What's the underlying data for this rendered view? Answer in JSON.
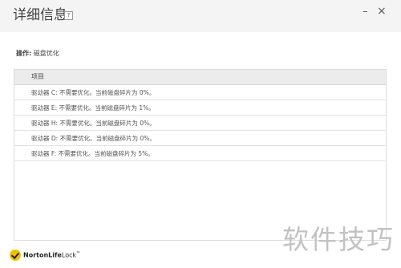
{
  "window": {
    "title": "详细信息",
    "help_label": "?",
    "minimize_label": "–",
    "close_label": "×"
  },
  "operation": {
    "label": "操作:",
    "value": "磁盘优化"
  },
  "table": {
    "header": "项目",
    "rows": [
      "驱动器 C: 不需要优化。当前磁盘碎片为 0%。",
      "驱动器 E: 不需要优化。当前磁盘碎片为 1%。",
      "驱动器 H: 不需要优化。当前磁盘碎片为 0%。",
      "驱动器 D: 不需要优化。当前磁盘碎片为 0%。",
      "驱动器 F: 不需要优化。当前磁盘碎片为 5%。"
    ]
  },
  "footer": {
    "logo_name": "NortonLife",
    "logo_suffix": "Lock",
    "logo_tm": "™",
    "brand_color": "#f2c200"
  },
  "watermark": "软件技巧"
}
